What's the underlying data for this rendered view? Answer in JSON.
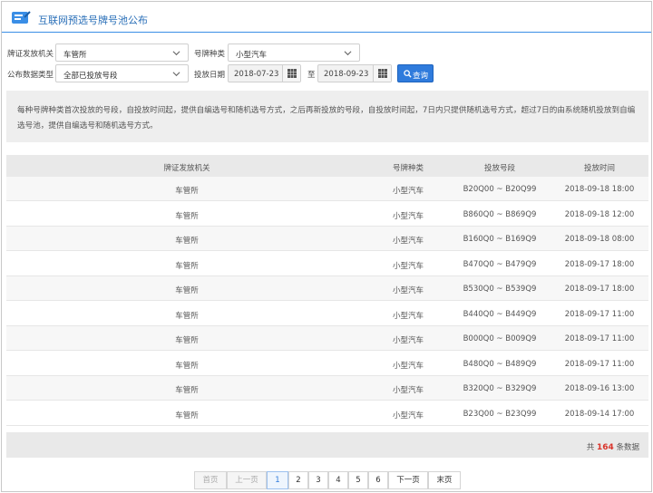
{
  "header": {
    "title": "互联网预选号牌号池公布"
  },
  "filters": {
    "authority_label": "牌证发放机关",
    "authority_value": "车管所",
    "plate_type_label": "号牌种类",
    "plate_type_value": "小型汽车",
    "data_type_label": "公布数据类型",
    "data_type_value": "全部已投放号段",
    "date_label": "投放日期",
    "date_from": "2018-07-23",
    "date_sep": "至",
    "date_to": "2018-09-23",
    "query_label": "查询"
  },
  "notice": "每种号牌种类首次投放的号段，自投放时间起，提供自编选号和随机选号方式，之后再新投放的号段，自投放时间起，7日内只提供随机选号方式，超过7日的由系统随机投放到自编选号池，提供自编选号和随机选号方式。",
  "table": {
    "columns": [
      "牌证发放机关",
      "号牌种类",
      "投放号段",
      "投放时间"
    ],
    "rows": [
      [
        "车管所",
        "小型汽车",
        "B20Q00 ~ B20Q99",
        "2018-09-18 18:00"
      ],
      [
        "车管所",
        "小型汽车",
        "B860Q0 ~ B869Q9",
        "2018-09-18 12:00"
      ],
      [
        "车管所",
        "小型汽车",
        "B160Q0 ~ B169Q9",
        "2018-09-18 08:00"
      ],
      [
        "车管所",
        "小型汽车",
        "B470Q0 ~ B479Q9",
        "2018-09-17 18:00"
      ],
      [
        "车管所",
        "小型汽车",
        "B530Q0 ~ B539Q9",
        "2018-09-17 18:00"
      ],
      [
        "车管所",
        "小型汽车",
        "B440Q0 ~ B449Q9",
        "2018-09-17 11:00"
      ],
      [
        "车管所",
        "小型汽车",
        "B000Q0 ~ B009Q9",
        "2018-09-17 11:00"
      ],
      [
        "车管所",
        "小型汽车",
        "B480Q0 ~ B489Q9",
        "2018-09-17 11:00"
      ],
      [
        "车管所",
        "小型汽车",
        "B320Q0 ~ B329Q9",
        "2018-09-16 13:00"
      ],
      [
        "车管所",
        "小型汽车",
        "B23Q00 ~ B23Q99",
        "2018-09-14 17:00"
      ]
    ]
  },
  "summary": {
    "prefix": "共",
    "count": "164",
    "suffix": "条数据"
  },
  "pager": {
    "first": "首页",
    "prev": "上一页",
    "pages": [
      "1",
      "2",
      "3",
      "4",
      "5",
      "6"
    ],
    "current": "1",
    "next": "下一页",
    "last": "末页"
  },
  "colors": {
    "accent": "#2f7bdc",
    "count": "#d9342b"
  }
}
